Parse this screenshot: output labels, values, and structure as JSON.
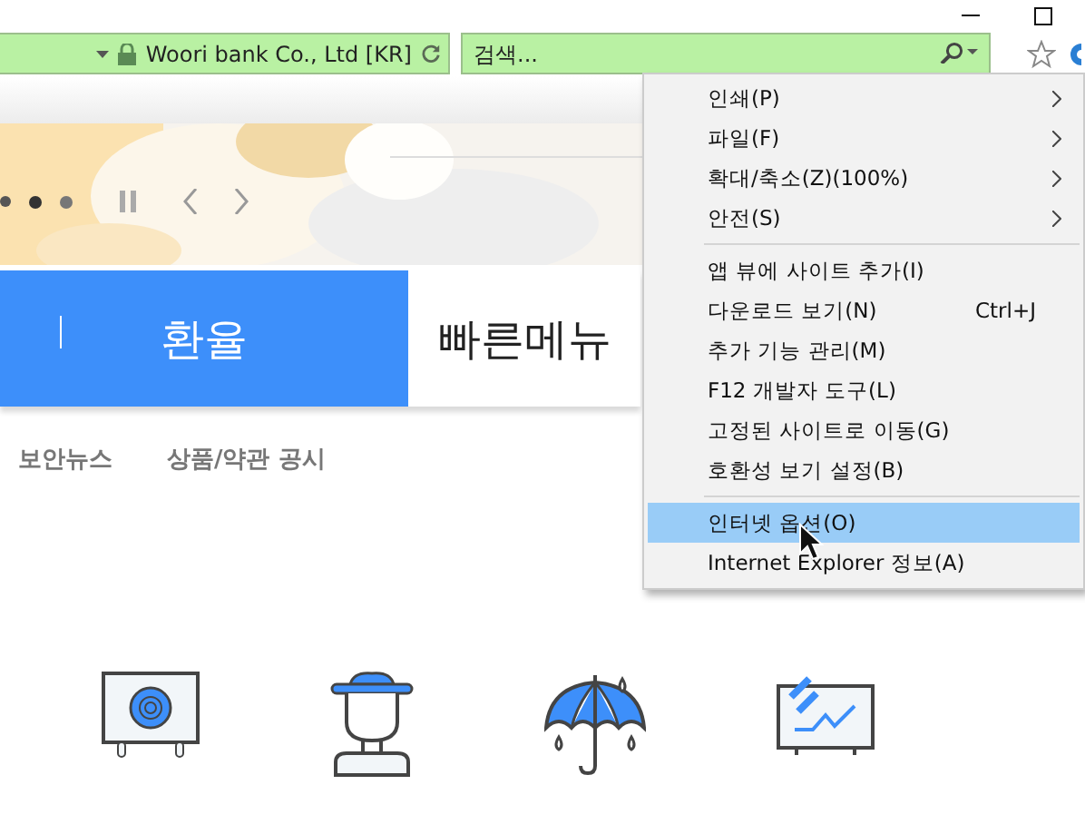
{
  "address_bar": {
    "site_identity": "Woori bank Co., Ltd [KR]"
  },
  "search": {
    "placeholder": "검색..."
  },
  "page": {
    "tabs": [
      {
        "label": "환율",
        "selected": true
      },
      {
        "label": "빠른메뉴",
        "selected": false
      }
    ],
    "links": [
      "보안뉴스",
      "상품/약관 공시"
    ]
  },
  "menu": {
    "items": [
      {
        "kind": "item",
        "label": "인쇄(P)",
        "submenu": true,
        "selected": false
      },
      {
        "kind": "item",
        "label": "파일(F)",
        "submenu": true,
        "selected": false
      },
      {
        "kind": "item",
        "label": "확대/축소(Z)(100%)",
        "submenu": true,
        "selected": false
      },
      {
        "kind": "item",
        "label": "안전(S)",
        "submenu": true,
        "selected": false
      },
      {
        "kind": "separator"
      },
      {
        "kind": "item",
        "label": "앱 뷰에 사이트 추가(I)",
        "submenu": false,
        "selected": false
      },
      {
        "kind": "item",
        "label": "다운로드 보기(N)",
        "shortcut": "Ctrl+J",
        "submenu": false,
        "selected": false
      },
      {
        "kind": "item",
        "label": "추가 기능 관리(M)",
        "submenu": false,
        "selected": false
      },
      {
        "kind": "item",
        "label": "F12 개발자 도구(L)",
        "submenu": false,
        "selected": false
      },
      {
        "kind": "item",
        "label": "고정된 사이트로 이동(G)",
        "submenu": false,
        "selected": false
      },
      {
        "kind": "item",
        "label": "호환성 보기 설정(B)",
        "submenu": false,
        "selected": false
      },
      {
        "kind": "separator"
      },
      {
        "kind": "item",
        "label": "인터넷 옵션(O)",
        "submenu": false,
        "selected": true
      },
      {
        "kind": "item",
        "label": "Internet Explorer 정보(A)",
        "submenu": false,
        "selected": false
      }
    ]
  }
}
